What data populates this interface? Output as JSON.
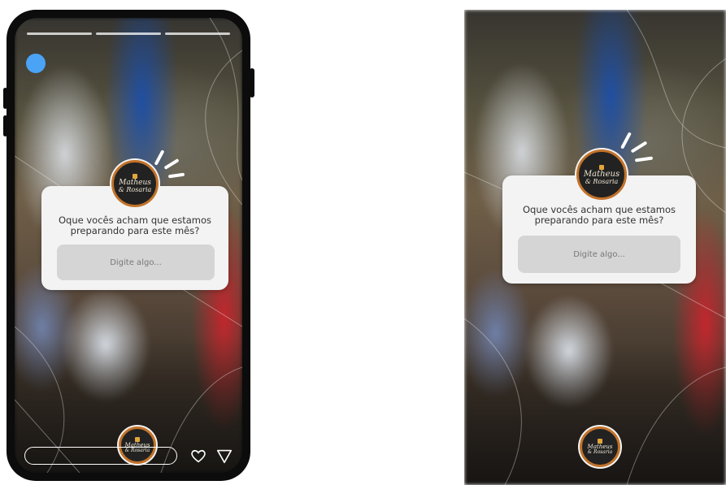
{
  "story": {
    "question": "Oque vocês acham que estamos preparando para este mês?",
    "placeholder": "Digite algo...",
    "progress_segments": 3
  },
  "logo": {
    "line1": "Matheus",
    "line2": "& Rosaria"
  },
  "icons": {
    "avatar": "avatar-icon",
    "heart": "heart-icon",
    "send": "send-icon"
  },
  "colors": {
    "avatar_dot": "#4aa3f5",
    "logo_ring": "#c2722a",
    "sticker_bg": "#f3f3f3",
    "answer_bg": "#d5d5d5"
  }
}
